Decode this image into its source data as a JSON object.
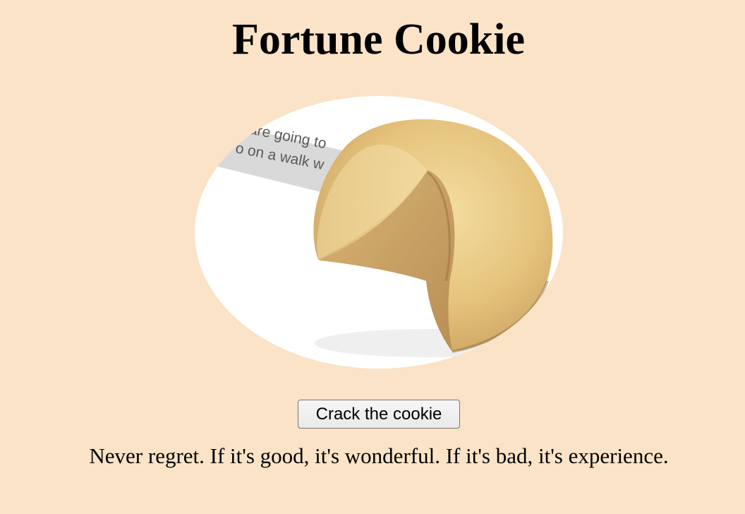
{
  "page": {
    "title": "Fortune Cookie",
    "background_color": "#fae3c7"
  },
  "cookie_image": {
    "icon": "fortune-cookie-image",
    "paper_text_line1": "are going to",
    "paper_text_line2": "o on a walk w"
  },
  "controls": {
    "crack_label": "Crack the cookie"
  },
  "fortune": {
    "text": "Never regret. If it's good, it's wonderful. If it's bad, it's experience."
  }
}
